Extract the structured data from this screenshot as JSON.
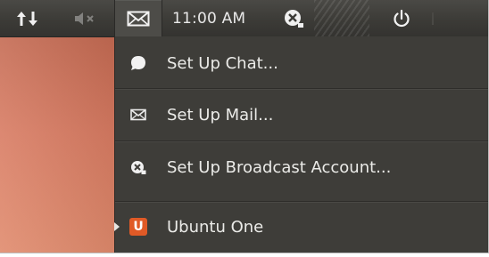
{
  "panel": {
    "clock": "11:00 AM",
    "icons": [
      "network-icon",
      "volume-muted-icon",
      "mail-icon",
      "gwibber-icon",
      "power-icon"
    ]
  },
  "menu": {
    "items": [
      {
        "label": "Set Up Chat...",
        "icon": "chat-bubble-icon"
      },
      {
        "label": "Set Up Mail...",
        "icon": "envelope-icon"
      },
      {
        "label": "Set Up Broadcast Account...",
        "icon": "broadcast-icon"
      },
      {
        "label": "Ubuntu One",
        "icon": "ubuntu-one-icon",
        "has_submenu": true
      }
    ]
  },
  "colors": {
    "panel": "#3c3b37",
    "menu": "#3e3d39",
    "text": "#ebebe8",
    "accent": "#e05a26",
    "wallpaper": "#d87b62"
  }
}
